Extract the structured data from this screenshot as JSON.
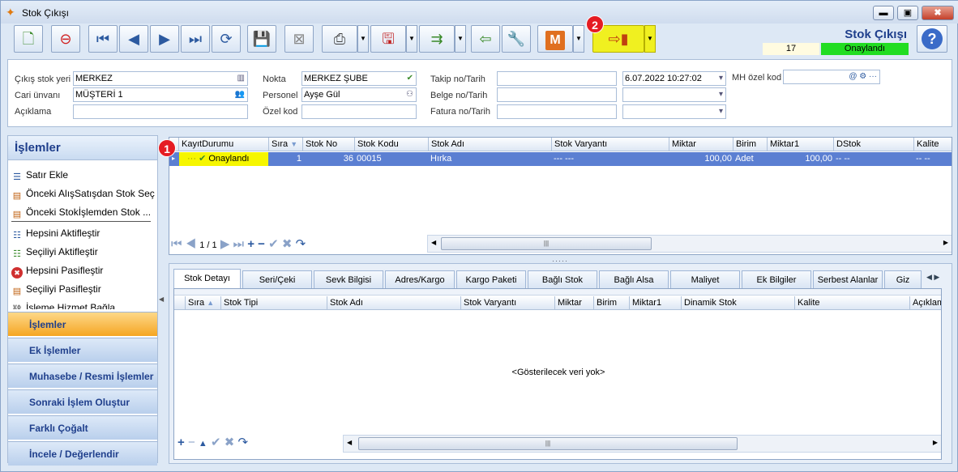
{
  "window": {
    "title": "Stok Çıkışı",
    "minimize": "▬",
    "maximize": "▣",
    "close": "✖"
  },
  "header": {
    "doc_title": "Stok Çıkışı",
    "number": "17",
    "status": "Onaylandı",
    "status_color": "#22dd22"
  },
  "markers": {
    "m1": "1",
    "m2": "2"
  },
  "toolbar": {
    "m_label": "M",
    "icons": [
      "new-doc-icon",
      "delete-doc-icon",
      "first-icon",
      "prev-icon",
      "next-icon",
      "last-icon",
      "refresh-icon",
      "save-icon",
      "save-cancel-icon",
      "print-icon",
      "pdf-save-icon",
      "export-icon",
      "import-icon",
      "tools-icon",
      "m-icon",
      "transfer-icon",
      "help-icon"
    ]
  },
  "form": {
    "cikis_stok_yeri_label": "Çıkış stok yeri",
    "cikis_stok_yeri": "MERKEZ",
    "cari_unvani_label": "Cari ünvanı",
    "cari_unvani": "MÜŞTERİ 1",
    "aciklama_label": "Açıklama",
    "aciklama": "",
    "nokta_label": "Nokta",
    "nokta": "MERKEZ ŞUBE",
    "personel_label": "Personel",
    "personel": "Ayşe Gül",
    "ozel_kod_label": "Özel kod",
    "ozel_kod": "",
    "takip_label": "Takip no/Tarih",
    "takip_no": "",
    "takip_tarih": "6.07.2022 10:27:02",
    "belge_label": "Belge no/Tarih",
    "belge_no": "",
    "belge_tarih": "",
    "fatura_label": "Fatura no/Tarih",
    "fatura_no": "",
    "fatura_tarih": "",
    "mh_ozel_kod_label": "MH özel kod",
    "mh_ozel_kod": ""
  },
  "left_panel": {
    "title": "İşlemler",
    "actions": [
      "Satır Ekle",
      "Önceki AlışSatışdan Stok Seç",
      "Önceki Stokİşlemden Stok ...",
      "Hepsini Aktifleştir",
      "Seçiliyi Aktifleştir",
      "Hepsini Pasifleştir",
      "Seçiliyi Pasifleştir",
      "İşleme Hizmet Bağla"
    ],
    "nav": [
      "İşlemler",
      "Ek İşlemler",
      "Muhasebe / Resmi İşlemler",
      "Sonraki İşlem Oluştur",
      "Farklı Çoğalt",
      "İncele / Değerlendir"
    ]
  },
  "main_grid": {
    "columns": [
      "KayıtDurumu",
      "Sıra",
      "Stok No",
      "Stok Kodu",
      "Stok Adı",
      "Stok Varyantı",
      "Miktar",
      "Birim",
      "Miktar1",
      "DStok",
      "Kalite"
    ],
    "row": {
      "durum": "Onaylandı",
      "sira": "1",
      "stok_no": "36",
      "stok_kodu": "00015",
      "stok_adi": "Hırka",
      "varyant": "--- ---",
      "miktar": "100,00",
      "birim": "Adet",
      "miktar1": "100,00",
      "dstok": "-- --",
      "kalite": "-- --"
    },
    "pager": "1 / 1"
  },
  "tabs": [
    "Stok Detayı",
    "Seri/Çeki",
    "Sevk Bilgisi",
    "Adres/Kargo",
    "Kargo Paketi",
    "Bağlı Stok",
    "Bağlı Alsa",
    "Maliyet",
    "Ek Bilgiler",
    "Serbest Alanlar",
    "Giz"
  ],
  "detail_grid": {
    "columns": [
      "Sıra",
      "Stok Tipi",
      "Stok Adı",
      "Stok Varyantı",
      "Miktar",
      "Birim",
      "Miktar1",
      "Dinamik Stok",
      "Kalite",
      "Açıklam"
    ],
    "empty_text": "<Gösterilecek veri yok>"
  }
}
